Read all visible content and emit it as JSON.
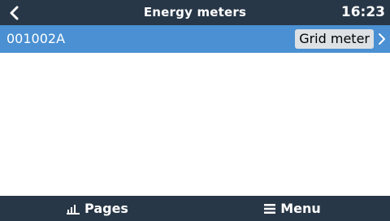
{
  "header": {
    "back_icon": "chevron-left-icon",
    "title": "Energy meters",
    "clock": "16:23"
  },
  "list": {
    "items": [
      {
        "label": "001002A",
        "value": "Grid meter",
        "selected": true,
        "chevron_icon": "chevron-right-icon"
      }
    ]
  },
  "footer": {
    "pages_label": "Pages",
    "pages_icon": "bar-chart-icon",
    "menu_label": "Menu",
    "menu_icon": "hamburger-menu-icon"
  },
  "colors": {
    "header_bg": "#283747",
    "selected_row_bg": "#4a90d2",
    "value_badge_bg": "#dde1e4"
  }
}
